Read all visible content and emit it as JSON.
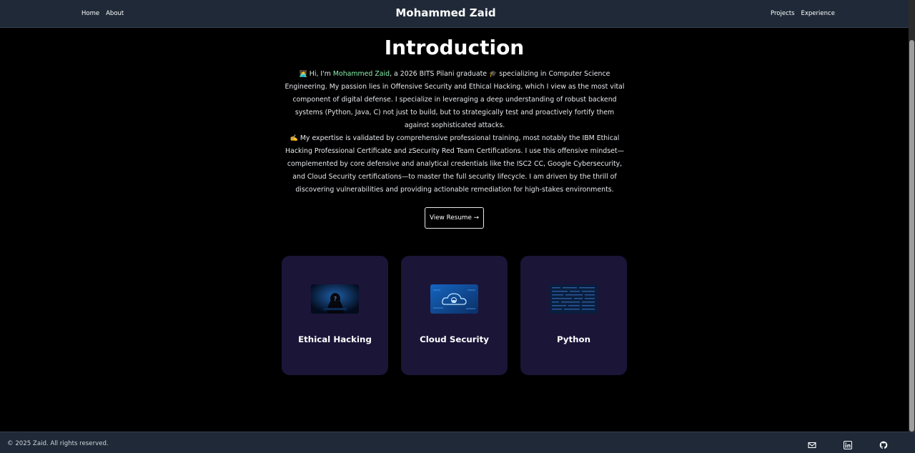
{
  "nav": {
    "brand": "Mohammed Zaid",
    "left_links": [
      "Home",
      "About"
    ],
    "right_links": [
      "Projects",
      "Experience"
    ]
  },
  "intro": {
    "title": "Introduction",
    "p1_emoji": "🧑‍💻",
    "p1_start": " Hi, I'm ",
    "p1_name": "Mohammed Zaid",
    "p1_mid": ", a 2026 BITS Pilani graduate ",
    "p1_cap": "🎓",
    "p1_rest": " specializing in Computer Science Engineering. My passion lies in Offensive Security and Ethical Hacking, which I view as the most vital component of digital defense. I specialize in leveraging a deep understanding of robust backend systems (Python, Java, C) not just to build, but to strategically test and proactively fortify them against sophisticated attacks.",
    "p2_emoji": "✍️",
    "p2_text": " My expertise is validated by comprehensive professional training, most notably the IBM Ethical Hacking Professional Certificate and zSecurity Red Team Certifications. I use this offensive mindset—complemented by core defensive and analytical credentials like the ISC2 CC, Google Cybersecurity, and Cloud Security certifications—to master the full security lifecycle. I am driven by the thrill of discovering vulnerabilities and providing actionable remediation for high-stakes environments.",
    "resume_button": "View Resume →"
  },
  "cards": [
    {
      "title": "Ethical Hacking",
      "image": "hooded-hacker-image"
    },
    {
      "title": "Cloud Security",
      "image": "cloud-lock-image"
    },
    {
      "title": "Python",
      "image": "code-matrix-image"
    }
  ],
  "footer": {
    "copyright": "© 2025 Zaid. All rights reserved.",
    "icons": [
      "mail-icon",
      "linkedin-icon",
      "github-icon"
    ]
  },
  "colors": {
    "page_bg": "#000000",
    "nav_bg": "#1f2937",
    "card_bg": "#1b1538",
    "name_highlight": "#86efac"
  }
}
